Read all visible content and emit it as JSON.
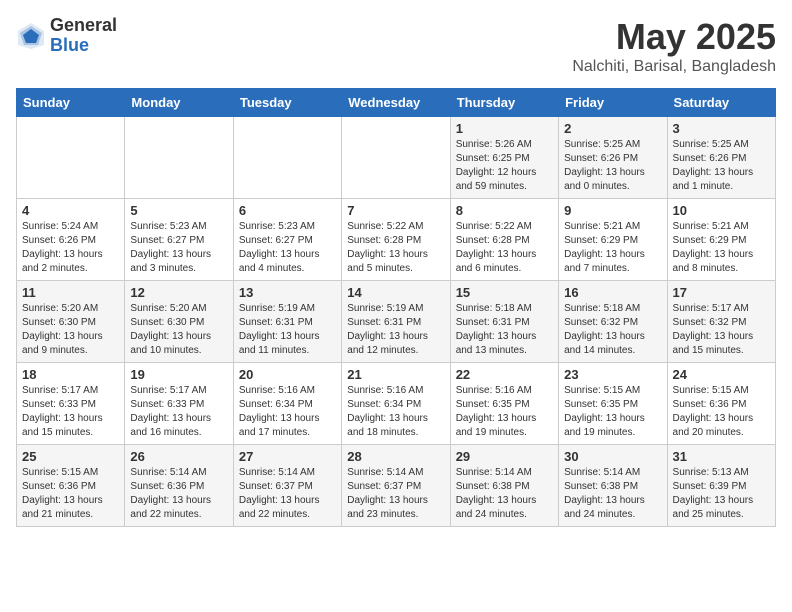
{
  "logo": {
    "general": "General",
    "blue": "Blue"
  },
  "title": "May 2025",
  "location": "Nalchiti, Barisal, Bangladesh",
  "days_of_week": [
    "Sunday",
    "Monday",
    "Tuesday",
    "Wednesday",
    "Thursday",
    "Friday",
    "Saturday"
  ],
  "weeks": [
    [
      {
        "day": "",
        "info": ""
      },
      {
        "day": "",
        "info": ""
      },
      {
        "day": "",
        "info": ""
      },
      {
        "day": "",
        "info": ""
      },
      {
        "day": "1",
        "info": "Sunrise: 5:26 AM\nSunset: 6:25 PM\nDaylight: 12 hours and 59 minutes."
      },
      {
        "day": "2",
        "info": "Sunrise: 5:25 AM\nSunset: 6:26 PM\nDaylight: 13 hours and 0 minutes."
      },
      {
        "day": "3",
        "info": "Sunrise: 5:25 AM\nSunset: 6:26 PM\nDaylight: 13 hours and 1 minute."
      }
    ],
    [
      {
        "day": "4",
        "info": "Sunrise: 5:24 AM\nSunset: 6:26 PM\nDaylight: 13 hours and 2 minutes."
      },
      {
        "day": "5",
        "info": "Sunrise: 5:23 AM\nSunset: 6:27 PM\nDaylight: 13 hours and 3 minutes."
      },
      {
        "day": "6",
        "info": "Sunrise: 5:23 AM\nSunset: 6:27 PM\nDaylight: 13 hours and 4 minutes."
      },
      {
        "day": "7",
        "info": "Sunrise: 5:22 AM\nSunset: 6:28 PM\nDaylight: 13 hours and 5 minutes."
      },
      {
        "day": "8",
        "info": "Sunrise: 5:22 AM\nSunset: 6:28 PM\nDaylight: 13 hours and 6 minutes."
      },
      {
        "day": "9",
        "info": "Sunrise: 5:21 AM\nSunset: 6:29 PM\nDaylight: 13 hours and 7 minutes."
      },
      {
        "day": "10",
        "info": "Sunrise: 5:21 AM\nSunset: 6:29 PM\nDaylight: 13 hours and 8 minutes."
      }
    ],
    [
      {
        "day": "11",
        "info": "Sunrise: 5:20 AM\nSunset: 6:30 PM\nDaylight: 13 hours and 9 minutes."
      },
      {
        "day": "12",
        "info": "Sunrise: 5:20 AM\nSunset: 6:30 PM\nDaylight: 13 hours and 10 minutes."
      },
      {
        "day": "13",
        "info": "Sunrise: 5:19 AM\nSunset: 6:31 PM\nDaylight: 13 hours and 11 minutes."
      },
      {
        "day": "14",
        "info": "Sunrise: 5:19 AM\nSunset: 6:31 PM\nDaylight: 13 hours and 12 minutes."
      },
      {
        "day": "15",
        "info": "Sunrise: 5:18 AM\nSunset: 6:31 PM\nDaylight: 13 hours and 13 minutes."
      },
      {
        "day": "16",
        "info": "Sunrise: 5:18 AM\nSunset: 6:32 PM\nDaylight: 13 hours and 14 minutes."
      },
      {
        "day": "17",
        "info": "Sunrise: 5:17 AM\nSunset: 6:32 PM\nDaylight: 13 hours and 15 minutes."
      }
    ],
    [
      {
        "day": "18",
        "info": "Sunrise: 5:17 AM\nSunset: 6:33 PM\nDaylight: 13 hours and 15 minutes."
      },
      {
        "day": "19",
        "info": "Sunrise: 5:17 AM\nSunset: 6:33 PM\nDaylight: 13 hours and 16 minutes."
      },
      {
        "day": "20",
        "info": "Sunrise: 5:16 AM\nSunset: 6:34 PM\nDaylight: 13 hours and 17 minutes."
      },
      {
        "day": "21",
        "info": "Sunrise: 5:16 AM\nSunset: 6:34 PM\nDaylight: 13 hours and 18 minutes."
      },
      {
        "day": "22",
        "info": "Sunrise: 5:16 AM\nSunset: 6:35 PM\nDaylight: 13 hours and 19 minutes."
      },
      {
        "day": "23",
        "info": "Sunrise: 5:15 AM\nSunset: 6:35 PM\nDaylight: 13 hours and 19 minutes."
      },
      {
        "day": "24",
        "info": "Sunrise: 5:15 AM\nSunset: 6:36 PM\nDaylight: 13 hours and 20 minutes."
      }
    ],
    [
      {
        "day": "25",
        "info": "Sunrise: 5:15 AM\nSunset: 6:36 PM\nDaylight: 13 hours and 21 minutes."
      },
      {
        "day": "26",
        "info": "Sunrise: 5:14 AM\nSunset: 6:36 PM\nDaylight: 13 hours and 22 minutes."
      },
      {
        "day": "27",
        "info": "Sunrise: 5:14 AM\nSunset: 6:37 PM\nDaylight: 13 hours and 22 minutes."
      },
      {
        "day": "28",
        "info": "Sunrise: 5:14 AM\nSunset: 6:37 PM\nDaylight: 13 hours and 23 minutes."
      },
      {
        "day": "29",
        "info": "Sunrise: 5:14 AM\nSunset: 6:38 PM\nDaylight: 13 hours and 24 minutes."
      },
      {
        "day": "30",
        "info": "Sunrise: 5:14 AM\nSunset: 6:38 PM\nDaylight: 13 hours and 24 minutes."
      },
      {
        "day": "31",
        "info": "Sunrise: 5:13 AM\nSunset: 6:39 PM\nDaylight: 13 hours and 25 minutes."
      }
    ]
  ]
}
